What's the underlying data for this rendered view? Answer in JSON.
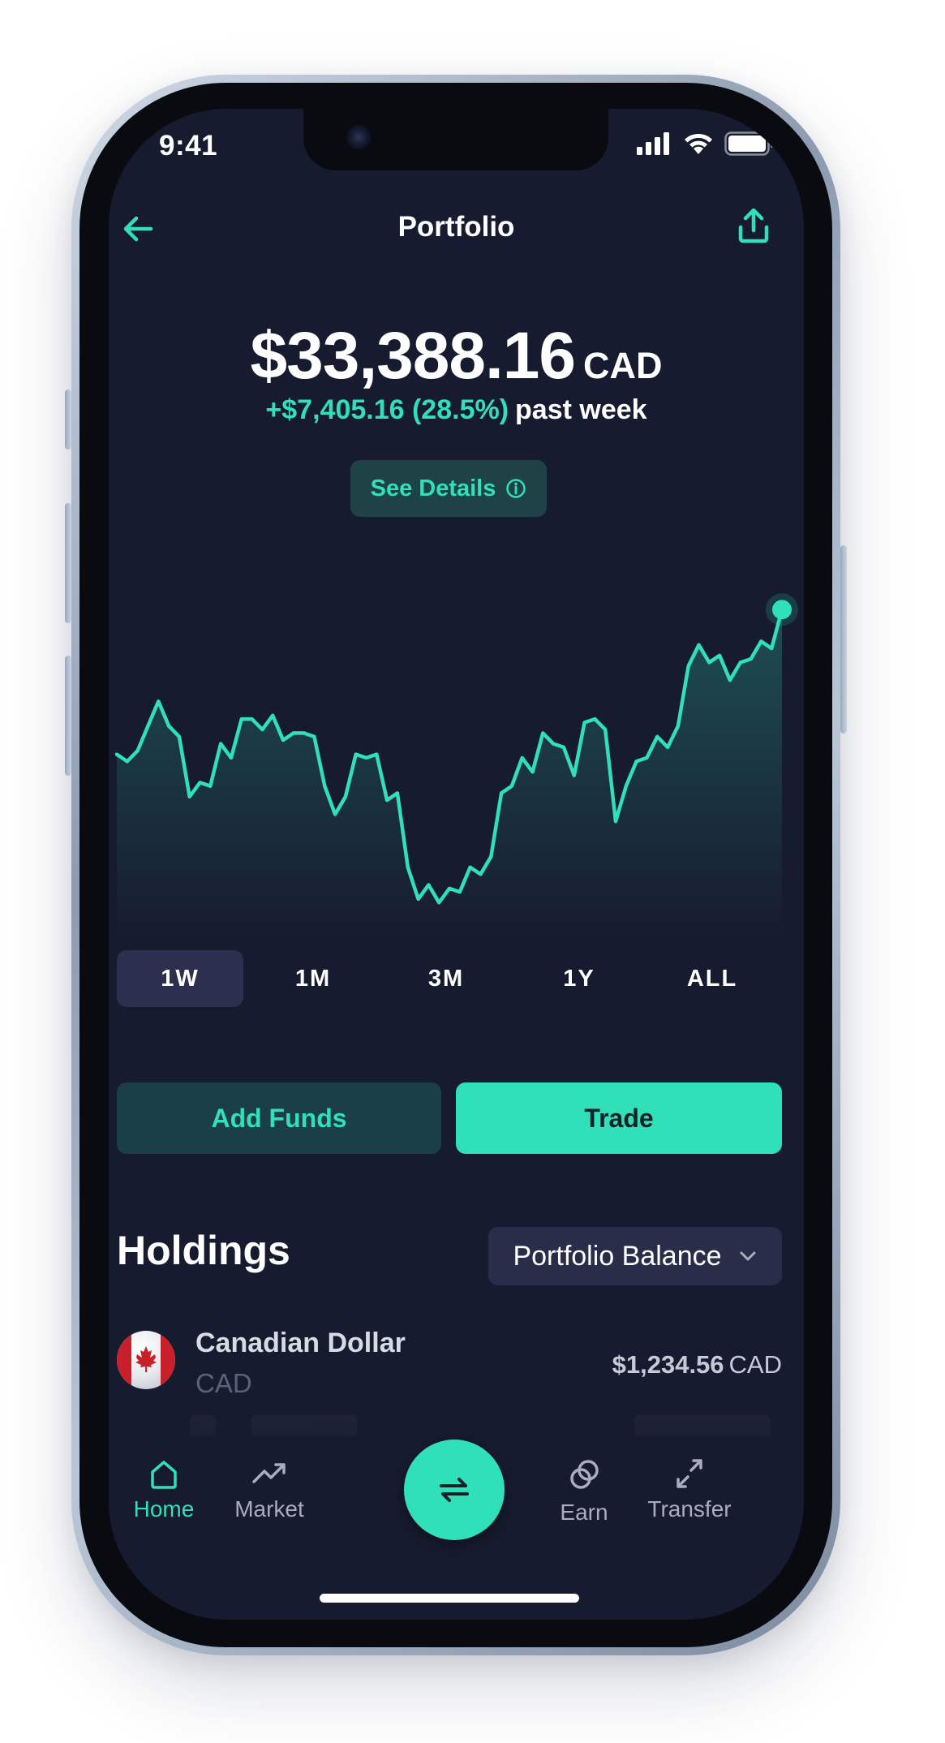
{
  "status_bar": {
    "time": "9:41"
  },
  "header": {
    "title": "Portfolio"
  },
  "balance": {
    "amount": "$33,388.16",
    "currency": "CAD",
    "change": "+$7,405.16 (28.5%)",
    "period_label": "past week"
  },
  "details_button": {
    "label": "See Details"
  },
  "chart_data": {
    "type": "area",
    "series": [
      {
        "values": [
          47,
          45,
          48,
          55,
          62,
          55,
          52,
          35,
          39,
          38,
          50,
          46,
          57,
          57,
          54,
          58,
          51,
          53,
          53,
          52,
          38,
          30,
          35,
          47,
          46,
          47,
          34,
          36,
          15,
          6,
          10,
          5,
          9,
          8,
          15,
          13,
          18,
          36,
          38,
          46,
          42,
          53,
          50,
          49,
          41,
          56,
          57,
          54,
          28,
          38,
          45,
          46,
          52,
          49,
          55,
          72,
          78,
          73,
          75,
          68,
          73,
          74,
          79,
          77,
          88
        ]
      }
    ],
    "highlight_last_point": true,
    "color": "#2fe0b9",
    "ylim": [
      0,
      100
    ]
  },
  "period_tabs": [
    {
      "label": "1W",
      "active": true
    },
    {
      "label": "1M",
      "active": false
    },
    {
      "label": "3M",
      "active": false
    },
    {
      "label": "1Y",
      "active": false
    },
    {
      "label": "ALL",
      "active": false
    }
  ],
  "actions": {
    "add_funds": "Add Funds",
    "trade": "Trade"
  },
  "holdings": {
    "title": "Holdings",
    "sort_dropdown": "Portfolio Balance",
    "items": [
      {
        "name": "Canadian Dollar",
        "code": "CAD",
        "amount": "$1,234.56",
        "amount_currency": "CAD",
        "flag_icon": "canada-flag-icon"
      }
    ]
  },
  "tabbar": {
    "home": "Home",
    "market": "Market",
    "earn": "Earn",
    "transfer": "Transfer"
  },
  "colors": {
    "accent": "#2fe0b9",
    "background": "#171b2f",
    "active_tab": "#2c2f4e"
  }
}
